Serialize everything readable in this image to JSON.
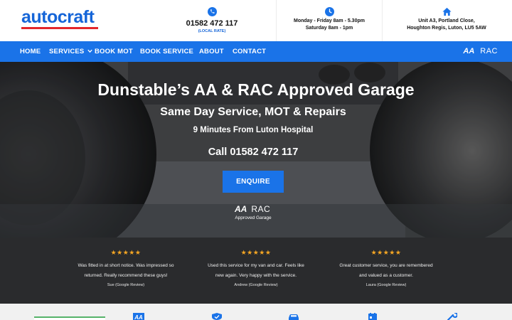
{
  "brand": {
    "name": "autocraft"
  },
  "header": {
    "phone": "01582 472 117",
    "phone_note": "(LOCAL RATE)",
    "hours_line1": "Monday - Friday 8am - 5.30pm",
    "hours_line2": "Saturday 8am - 1pm",
    "address_line1": "Unit A3, Portland Close,",
    "address_line2": "Houghton Regis, Luton, LU5 5AW",
    "icons": [
      "phone-icon",
      "clock-icon",
      "home-icon"
    ]
  },
  "nav": {
    "items": [
      "HOME",
      "SERVICES",
      "BOOK MOT",
      "BOOK SERVICE",
      "ABOUT",
      "CONTACT"
    ],
    "logo_aa": "AA",
    "logo_rac": "RAC"
  },
  "hero": {
    "title": "Dunstable’s AA & RAC Approved Garage",
    "subtitle": "Same Day Service, MOT & Repairs",
    "tagline": "9 Minutes From Luton Hospital",
    "call": "Call 01582 472 117",
    "cta": "ENQUIRE",
    "logo_aa": "AA",
    "logo_rac": "RAC",
    "approved": "Approved Garage"
  },
  "reviews": [
    {
      "stars": "★★★★★",
      "line1": "Was fitted in at short notice. Was impressed so",
      "line2": "returned. Really recommend these guys!",
      "author": "Sue (Google Review)"
    },
    {
      "stars": "★★★★★",
      "line1": "Used this service for my van and car. Feels like",
      "line2": "new again. Very happy with the service.",
      "author": "Andrew (Google Review)"
    },
    {
      "stars": "★★★★★",
      "line1": "Great customer service, you are remembered",
      "line2": "and valued as a customer.",
      "author": "Laura (Google Review)"
    }
  ],
  "bottom_icons": [
    "aa-badge-icon",
    "shield-check-icon",
    "car-icon",
    "calendar-icon",
    "wrench-icon"
  ],
  "colors": {
    "brand_blue": "#1a73e8",
    "logo_red": "#e3262b",
    "star": "#f5a623",
    "review_bg": "#2a2b2d"
  }
}
